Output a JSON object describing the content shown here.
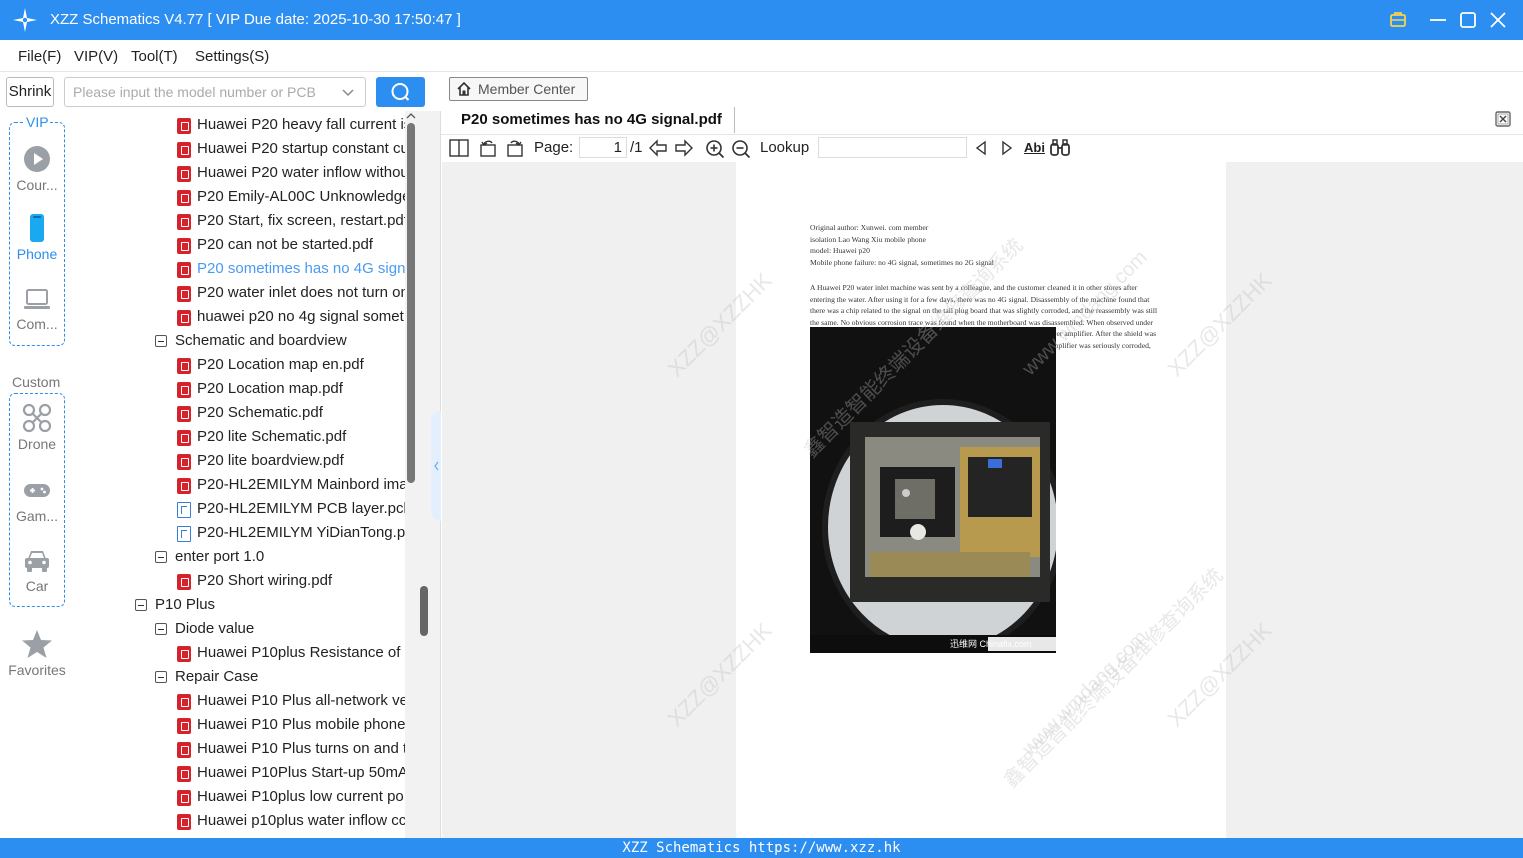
{
  "window": {
    "title": "XZZ Schematics V4.77 [ VIP Due date: 2025-10-30 17:50:47 ]",
    "brand_color": "#2c8ef0"
  },
  "menu": {
    "file": "File(F)",
    "vip": "VIP(V)",
    "tool": "Tool(T)",
    "settings": "Settings(S)"
  },
  "search": {
    "shrink_label": "Shrink",
    "placeholder": "Please input the model number or PCB"
  },
  "sidebar": {
    "vip_label": "VIP",
    "custom_label": "Custom",
    "courses": "Cour...",
    "phone": "Phone",
    "computer": "Com...",
    "drone": "Drone",
    "game": "Gam...",
    "car": "Car",
    "favorites": "Favorites"
  },
  "tree": [
    {
      "label": "Huawei P20 heavy fall current is",
      "type": "pdf",
      "level": 3
    },
    {
      "label": "Huawei P20 startup constant cu",
      "type": "pdf",
      "level": 3
    },
    {
      "label": "Huawei P20 water inflow withou",
      "type": "pdf",
      "level": 3
    },
    {
      "label": "P20 Emily-AL00C Unknowledge",
      "type": "pdf",
      "level": 3
    },
    {
      "label": "P20 Start, fix screen, restart.pdf",
      "type": "pdf",
      "level": 3
    },
    {
      "label": "P20 can not be started.pdf",
      "type": "pdf",
      "level": 3
    },
    {
      "label": "P20 sometimes has no 4G signa",
      "type": "pdf",
      "level": 3,
      "selected": true
    },
    {
      "label": "P20 water inlet does not turn on",
      "type": "pdf",
      "level": 3
    },
    {
      "label": "huawei p20 no 4g signal somet",
      "type": "pdf",
      "level": 3
    },
    {
      "label": "Schematic and boardview",
      "type": "folder",
      "level": 2
    },
    {
      "label": "P20 Location map en.pdf",
      "type": "pdf",
      "level": 3
    },
    {
      "label": "P20 Location map.pdf",
      "type": "pdf",
      "level": 3
    },
    {
      "label": "P20 Schematic.pdf",
      "type": "pdf",
      "level": 3
    },
    {
      "label": "P20 lite Schematic.pdf",
      "type": "pdf",
      "level": 3
    },
    {
      "label": "P20 lite boardview.pdf",
      "type": "pdf",
      "level": 3
    },
    {
      "label": "P20-HL2EMILYM Mainbord ima",
      "type": "pdf",
      "level": 3
    },
    {
      "label": "P20-HL2EMILYM PCB layer.pcb",
      "type": "pcb",
      "level": 3
    },
    {
      "label": "P20-HL2EMILYM YiDianTong.pc",
      "type": "pcb",
      "level": 3
    },
    {
      "label": "enter port 1.0",
      "type": "folder",
      "level": 2
    },
    {
      "label": "P20 Short wiring.pdf",
      "type": "pdf",
      "level": 3
    },
    {
      "label": "P10 Plus",
      "type": "folder",
      "level": 1
    },
    {
      "label": "Diode value",
      "type": "folder",
      "level": 2
    },
    {
      "label": "Huawei P10plus Resistance of c",
      "type": "pdf",
      "level": 3
    },
    {
      "label": "Repair Case",
      "type": "folder",
      "level": 2
    },
    {
      "label": "Huawei P10 Plus all-network ve",
      "type": "pdf",
      "level": 3
    },
    {
      "label": "Huawei P10 Plus mobile phone",
      "type": "pdf",
      "level": 3
    },
    {
      "label": "Huawei P10 Plus turns on and t",
      "type": "pdf",
      "level": 3
    },
    {
      "label": "Huawei P10Plus Start-up 50mA",
      "type": "pdf",
      "level": 3
    },
    {
      "label": "Huawei P10plus low current po",
      "type": "pdf",
      "level": 3
    },
    {
      "label": "Huawei p10plus water inflow cc",
      "type": "pdf",
      "level": 3
    }
  ],
  "viewer": {
    "member_center": "Member Center",
    "doc_tab": "P20 sometimes has no 4G signal.pdf",
    "page_label": "Page:",
    "page_current": "1",
    "page_total": "/1",
    "lookup_label": "Lookup",
    "lookup_value": "",
    "abi_label": "Abi"
  },
  "pdf": {
    "header_lines": [
      "Original author: Xunwei. com member",
      "isolation Lao Wang Xiu mobile phone",
      "model: Huawei p20",
      "Mobile phone failure: no 4G signal, sometimes no 2G signal"
    ],
    "body": "A Huawei P20 water inlet machine was sent by a colleague, and the customer cleaned it in other stores after entering the water. After using it for a few days, there was no 4G signal. Disassembly of the machine found that there was a chip related to the signal on the tail plug board that was slightly corroded, and the reassembly was still the same. No obvious corrosion trace was found when the motherboard was disassembled. When observed under the microscope, it was found that there was a small shield on the back of the power amplifier. After the shield was removed, it was found that one end of a resistor supplying power to the power amplifier was seriously corroded, and the resistor was removed for short-circuit repair.",
    "photo_caption": "迅维网 Chinafix.com",
    "watermarks": [
      "XZZ@XZZHK",
      "www.wmdang.com",
      "鑫智造智能终端设备维修查询系统"
    ]
  },
  "footer": {
    "text": "XZZ Schematics https://www.xzz.hk"
  }
}
